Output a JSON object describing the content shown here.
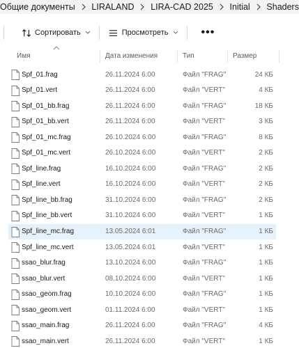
{
  "breadcrumb": [
    "Общие документы",
    "LIRALAND",
    "LIRA-CAD 2025",
    "Initial",
    "Shaders"
  ],
  "toolbar": {
    "sort_label": "Сортировать",
    "view_label": "Просмотреть",
    "more_label": "•••"
  },
  "columns": {
    "name": "Имя",
    "date": "Дата изменения",
    "type": "Тип",
    "size": "Размер"
  },
  "files": [
    {
      "name": "Spf_01.frag",
      "date": "26.11.2024 6:00",
      "type": "Файл \"FRAG\"",
      "size": "24 КБ"
    },
    {
      "name": "Spf_01.vert",
      "date": "26.11.2024 6:00",
      "type": "Файл \"VERT\"",
      "size": "4 КБ"
    },
    {
      "name": "Spf_01_bb.frag",
      "date": "26.11.2024 6:00",
      "type": "Файл \"FRAG\"",
      "size": "18 КБ"
    },
    {
      "name": "Spf_01_bb.vert",
      "date": "26.11.2024 6:00",
      "type": "Файл \"VERT\"",
      "size": "3 КБ"
    },
    {
      "name": "Spf_01_mc.frag",
      "date": "26.10.2024 6:00",
      "type": "Файл \"FRAG\"",
      "size": "8 КБ"
    },
    {
      "name": "Spf_01_mc.vert",
      "date": "26.10.2024 6:00",
      "type": "Файл \"VERT\"",
      "size": "2 КБ"
    },
    {
      "name": "Spf_line.frag",
      "date": "16.10.2024 6:00",
      "type": "Файл \"FRAG\"",
      "size": "2 КБ"
    },
    {
      "name": "Spf_line.vert",
      "date": "16.10.2024 6:00",
      "type": "Файл \"VERT\"",
      "size": "2 КБ"
    },
    {
      "name": "Spf_line_bb.frag",
      "date": "31.10.2024 6:00",
      "type": "Файл \"FRAG\"",
      "size": "2 КБ"
    },
    {
      "name": "Spf_line_bb.vert",
      "date": "31.10.2024 6:00",
      "type": "Файл \"VERT\"",
      "size": "1 КБ"
    },
    {
      "name": "Spf_line_mc.frag",
      "date": "13.05.2024 6:01",
      "type": "Файл \"FRAG\"",
      "size": "1 КБ"
    },
    {
      "name": "Spf_line_mc.vert",
      "date": "13.05.2024 6:01",
      "type": "Файл \"VERT\"",
      "size": "1 КБ"
    },
    {
      "name": "ssao_blur.frag",
      "date": "13.10.2024 6:00",
      "type": "Файл \"FRAG\"",
      "size": "1 КБ"
    },
    {
      "name": "ssao_blur.vert",
      "date": "08.10.2024 6:00",
      "type": "Файл \"VERT\"",
      "size": "1 КБ"
    },
    {
      "name": "ssao_geom.frag",
      "date": "10.10.2024 6:00",
      "type": "Файл \"FRAG\"",
      "size": "1 КБ"
    },
    {
      "name": "ssao_geom.vert",
      "date": "01.11.2024 6:00",
      "type": "Файл \"VERT\"",
      "size": "1 КБ"
    },
    {
      "name": "ssao_main.frag",
      "date": "26.11.2024 6:00",
      "type": "Файл \"FRAG\"",
      "size": "4 КБ"
    },
    {
      "name": "ssao_main.vert",
      "date": "26.11.2024 6:00",
      "type": "Файл \"VERT\"",
      "size": "1 КБ"
    }
  ],
  "selected_file": "Spf_line_mc.frag",
  "colors": {
    "selection": "#e5f1fb",
    "breadcrumb_bg": "#f3f3f3",
    "secondary_text": "#6b6b6b"
  }
}
